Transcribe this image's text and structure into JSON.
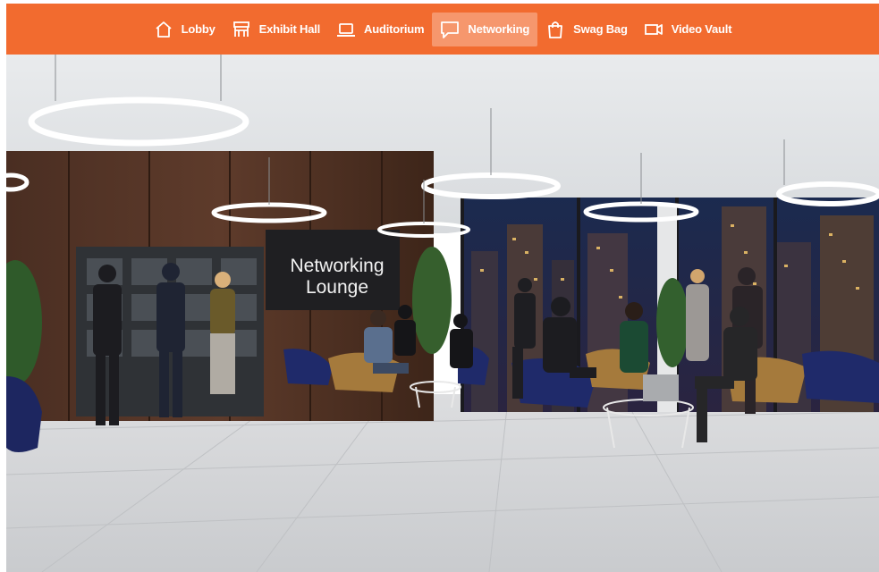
{
  "nav": {
    "items": [
      {
        "label": "Lobby",
        "icon": "home-icon",
        "active": false
      },
      {
        "label": "Exhibit Hall",
        "icon": "booth-icon",
        "active": false
      },
      {
        "label": "Auditorium",
        "icon": "laptop-icon",
        "active": false
      },
      {
        "label": "Networking",
        "icon": "chat-icon",
        "active": true
      },
      {
        "label": "Swag Bag",
        "icon": "bag-icon",
        "active": false
      },
      {
        "label": "Video Vault",
        "icon": "video-camera-icon",
        "active": false
      }
    ]
  },
  "scene": {
    "sign": {
      "line1": "Networking",
      "line2": "Lounge"
    }
  },
  "colors": {
    "nav_background": "#f26b2f",
    "nav_text": "#ffffff",
    "active_highlight": "rgba(255,255,255,0.3)"
  }
}
